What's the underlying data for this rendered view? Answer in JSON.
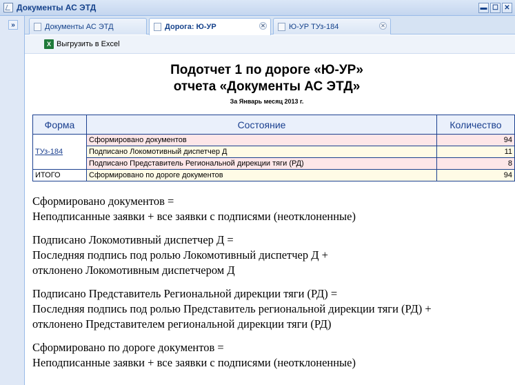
{
  "window": {
    "title": "Документы АС ЭТД"
  },
  "window_buttons": {
    "minimize": "▬",
    "maximize": "☐",
    "close": "✕"
  },
  "leftstrip": {
    "expand_glyph": "»"
  },
  "tabs": [
    {
      "label": "Документы АС ЭТД",
      "active": false,
      "closable": false
    },
    {
      "label": "Дорога: Ю-УР",
      "active": true,
      "closable": true
    },
    {
      "label": "Ю-УР ТУз-184",
      "active": false,
      "closable": true
    }
  ],
  "toolbar": {
    "export_label": "Выгрузить в Excel",
    "export_icon": "excel-icon"
  },
  "report": {
    "title_line1": "Подотчет 1 по дороге «Ю-УР»",
    "title_line2": "отчета «Документы АС ЭТД»",
    "subtitle": "За Январь месяц 2013 г.",
    "columns": [
      "Форма",
      "Состояние",
      "Количество"
    ],
    "form_link": "ТУз-184",
    "rows": [
      {
        "state": "Сформировано документов",
        "count": "94"
      },
      {
        "state": "Подписано Локомотивный диспетчер Д",
        "count": "11"
      },
      {
        "state": "Подписано Представитель Региональной дирекции тяги (РД)",
        "count": "8"
      }
    ],
    "total": {
      "form": "ИТОГО",
      "state": "Сформировано по дороге документов",
      "count": "94"
    }
  },
  "descriptions": [
    {
      "lines": [
        "Сформировано документов =",
        "Неподписанные заявки + все заявки с подписями (неотклоненные)"
      ]
    },
    {
      "lines": [
        "Подписано Локомотивный диспетчер Д =",
        "Последняя подпись под ролью Локомотивный диспетчер Д +",
        "отклонено Локомотивным диспетчером Д"
      ]
    },
    {
      "lines": [
        "Подписано Представитель Региональной дирекции тяги (РД) =",
        "Последняя подпись под ролью Представитель региональной дирекции тяги (РД) +",
        "отклонено Представителем региональной дирекции тяги (РД)"
      ]
    },
    {
      "lines": [
        "Сформировано по дороге документов =",
        "Неподписанные заявки + все заявки с подписями (неотклоненные)"
      ]
    }
  ]
}
